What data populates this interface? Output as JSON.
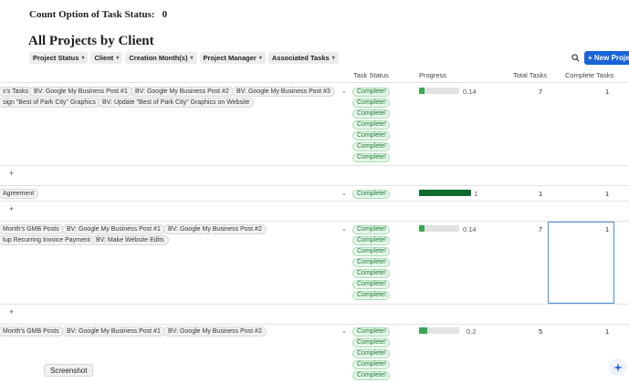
{
  "count": {
    "label": "Count Option of Task Status:",
    "value": "0"
  },
  "page_title": "All Projects by Client",
  "filters": [
    "Project Status",
    "Client",
    "Creation Month(s)",
    "Project Manager",
    "Associated Tasks"
  ],
  "new_button_label": "+ New Projects",
  "columns": {
    "task_status": "Task Status",
    "progress": "Progress",
    "total_tasks": "Total Tasks",
    "complete_tasks": "Complete Tasks"
  },
  "rows": [
    {
      "tasks": [
        "s's Tasks",
        "BV: Google My Business Post #1",
        "BV: Google My Business Post #2",
        "BV: Google My Business Post #3",
        "sign \"Best of Park City\" Graphics",
        "BV: Update \"Best of Park City\" Graphics on Website"
      ],
      "statuses": [
        "Complete!",
        "Complete!",
        "Complete!",
        "Complete!",
        "Complete!",
        "Complete!",
        "Complete!"
      ],
      "progress": 0.14,
      "progress_label": "0.14",
      "total": "7",
      "complete": "1"
    },
    {
      "tasks": [
        "Agreement"
      ],
      "statuses": [
        "Complete!"
      ],
      "progress": 1,
      "progress_label": "1",
      "total": "1",
      "complete": "1"
    },
    {
      "tasks": [
        "Month's GMB Posts",
        "BV: Google My Business Post #1",
        "BV: Google My Business Post #2",
        "tup Recurring Invoice Payment",
        "BV: Make Website Edits"
      ],
      "statuses": [
        "Complete!",
        "Complete!",
        "Complete!",
        "Complete!",
        "Complete!",
        "Complete!",
        "Complete!"
      ],
      "progress": 0.14,
      "progress_label": "0.14",
      "total": "7",
      "complete": "1"
    },
    {
      "tasks": [
        "Month's GMB Posts",
        "BV: Google My Business Post #1",
        "BV: Google My Business Post #2"
      ],
      "statuses": [
        "Complete!",
        "Complete!",
        "Complete!",
        "Complete!",
        "Complete!"
      ],
      "progress": 0.2,
      "progress_label": "0.2",
      "total": "5",
      "complete": "1"
    }
  ],
  "add_row_label": "+",
  "tooltip": "Screenshot",
  "icons": {
    "search": "search-icon",
    "sparkle": "sparkle-icon",
    "chevron": "chevron-down-icon"
  }
}
